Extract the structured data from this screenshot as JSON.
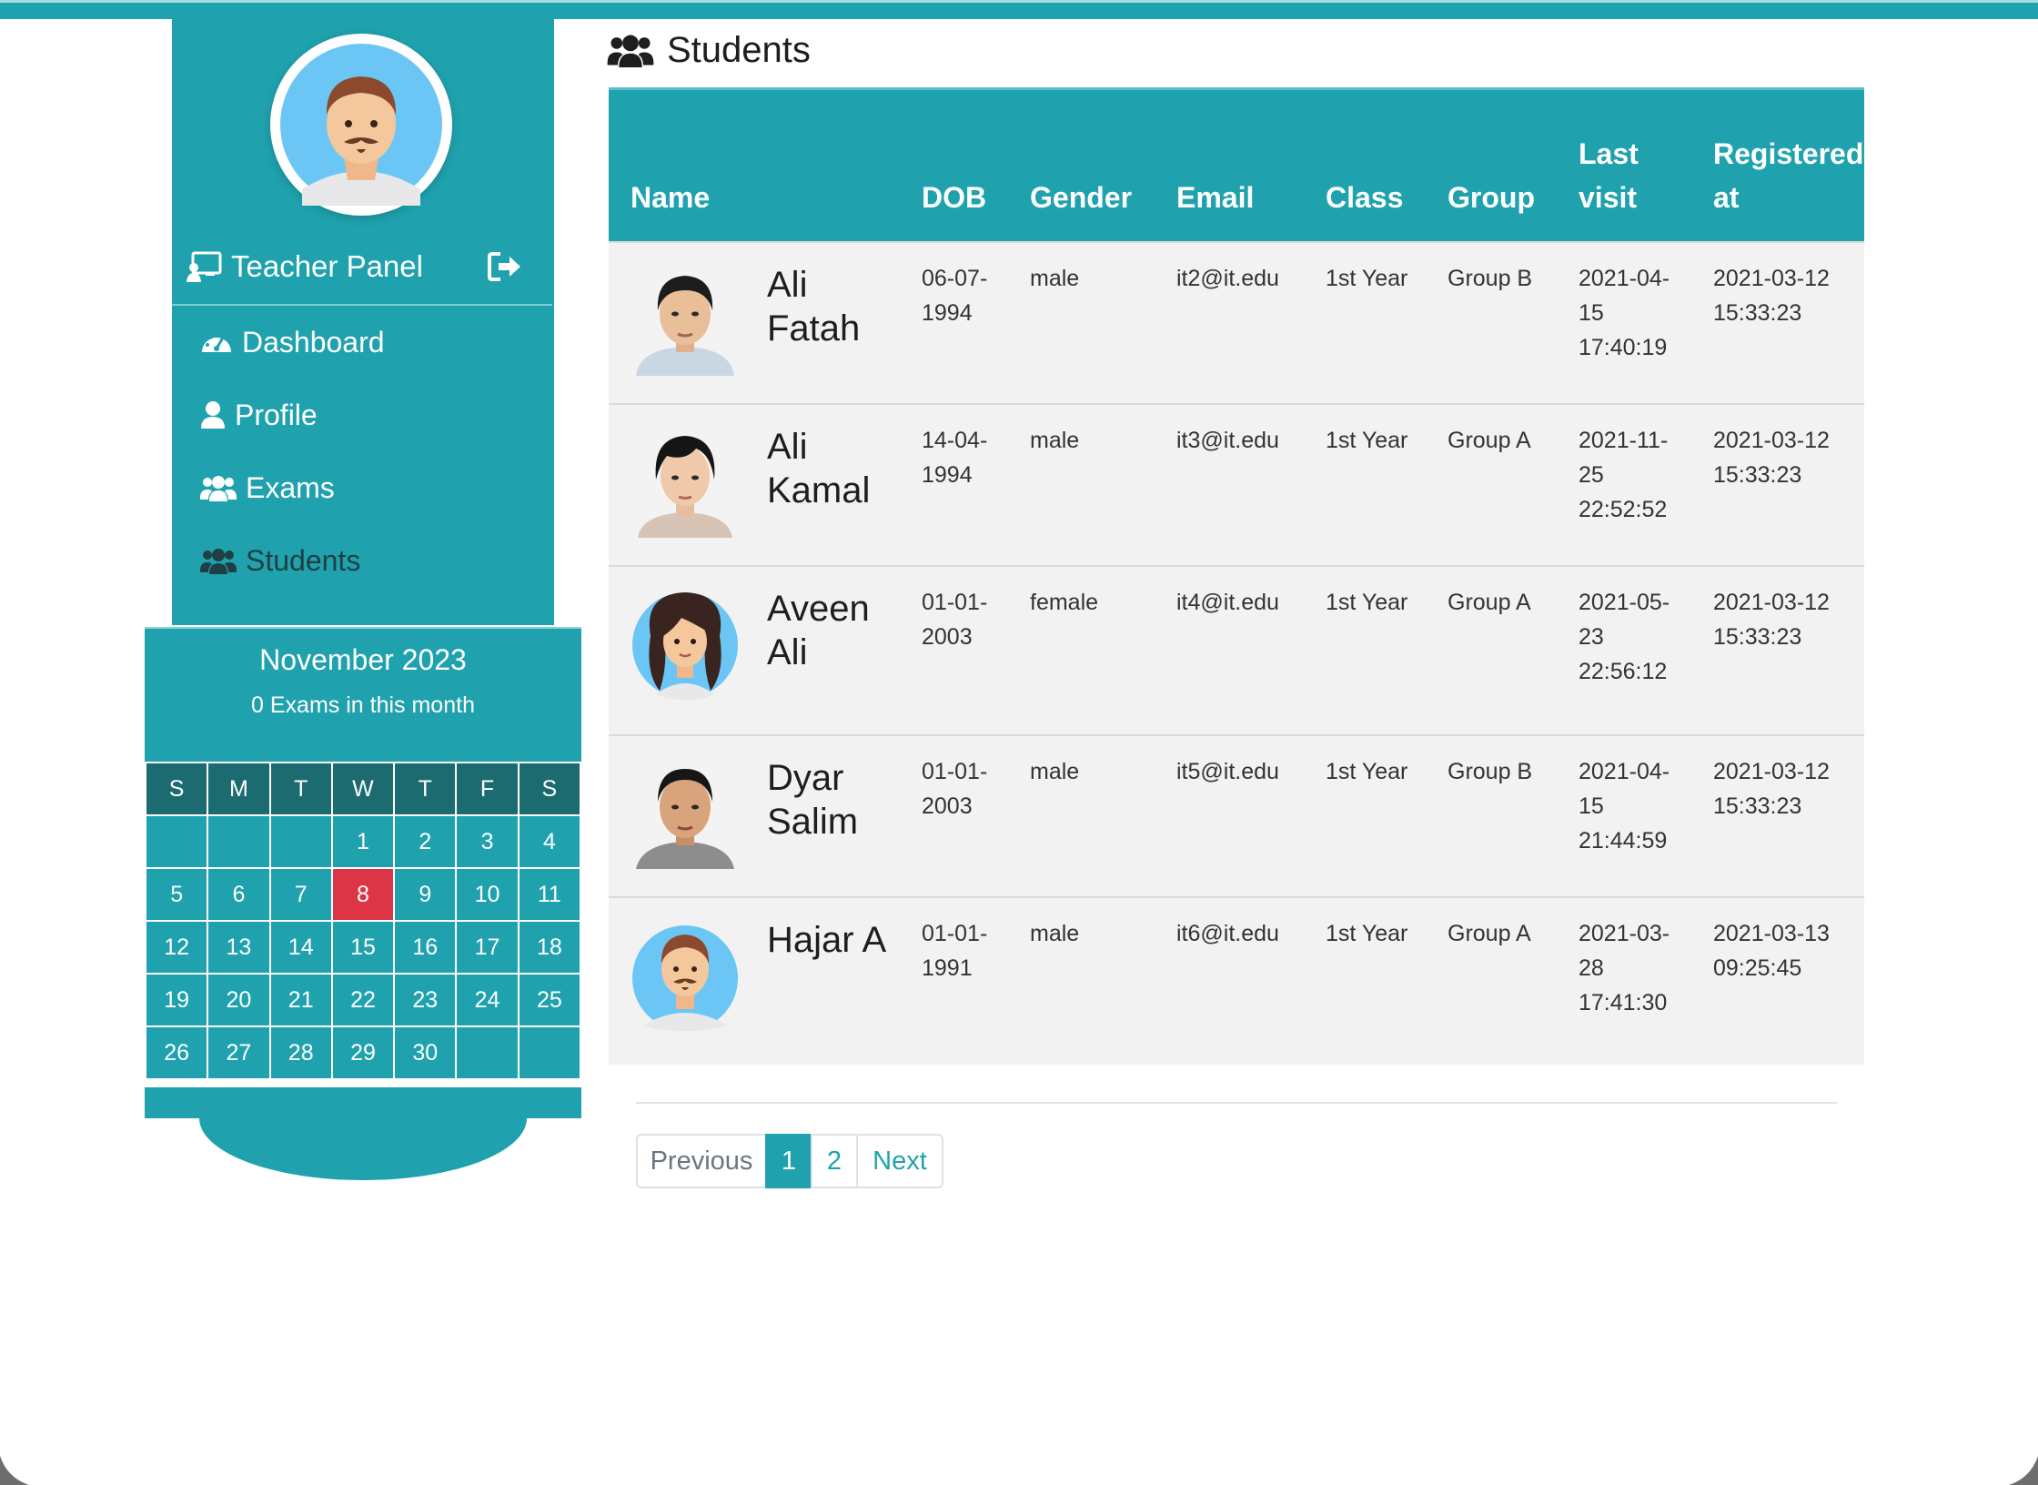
{
  "colors": {
    "accent": "#1fa2ae",
    "accent_dark": "#1b6b70",
    "today": "#dc3545"
  },
  "sidebar": {
    "panel_title": "Teacher Panel",
    "nav": [
      {
        "label": "Dashboard",
        "icon": "gauge-icon"
      },
      {
        "label": "Profile",
        "icon": "user-icon"
      },
      {
        "label": "Exams",
        "icon": "users-icon"
      },
      {
        "label": "Students",
        "icon": "users-icon",
        "active": true
      }
    ]
  },
  "calendar": {
    "month": "November 2023",
    "exam_count": "0 Exams in this month",
    "weekdays": [
      "S",
      "M",
      "T",
      "W",
      "T",
      "F",
      "S"
    ],
    "weeks": [
      [
        "",
        "",
        "",
        "1",
        "2",
        "3",
        "4"
      ],
      [
        "5",
        "6",
        "7",
        "8",
        "9",
        "10",
        "11"
      ],
      [
        "12",
        "13",
        "14",
        "15",
        "16",
        "17",
        "18"
      ],
      [
        "19",
        "20",
        "21",
        "22",
        "23",
        "24",
        "25"
      ],
      [
        "26",
        "27",
        "28",
        "29",
        "30",
        "",
        ""
      ]
    ],
    "today": "8"
  },
  "main": {
    "title": "Students",
    "columns": [
      "Name",
      "DOB",
      "Gender",
      "Email",
      "Class",
      "Group",
      "Last visit",
      "Registered at"
    ],
    "rows": [
      {
        "name": "Ali Fatah",
        "dob": "06-07-1994",
        "gender": "male",
        "email": "it2@it.edu",
        "class": "1st Year",
        "group": "Group B",
        "last_visit": "2021-04-15 17:40:19",
        "registered": "2021-03-12 15:33:23",
        "photo": "photo-male-asian"
      },
      {
        "name": "Ali Kamal",
        "dob": "14-04-1994",
        "gender": "male",
        "email": "it3@it.edu",
        "class": "1st Year",
        "group": "Group A",
        "last_visit": "2021-11-25 22:52:52",
        "registered": "2021-03-12 15:33:23",
        "photo": "photo-male-asian-2"
      },
      {
        "name": "Aveen Ali",
        "dob": "01-01-2003",
        "gender": "female",
        "email": "it4@it.edu",
        "class": "1st Year",
        "group": "Group A",
        "last_visit": "2021-05-23 22:56:12",
        "registered": "2021-03-12 15:33:23",
        "photo": "avatar-female"
      },
      {
        "name": "Dyar Salim",
        "dob": "01-01-2003",
        "gender": "male",
        "email": "it5@it.edu",
        "class": "1st Year",
        "group": "Group B",
        "last_visit": "2021-04-15 21:44:59",
        "registered": "2021-03-12 15:33:23",
        "photo": "photo-male-asian-3"
      },
      {
        "name": "Hajar A",
        "dob": "01-01-1991",
        "gender": "male",
        "email": "it6@it.edu",
        "class": "1st Year",
        "group": "Group A",
        "last_visit": "2021-03-28 17:41:30",
        "registered": "2021-03-13 09:25:45",
        "photo": "avatar-male"
      }
    ]
  },
  "pagination": {
    "previous": "Previous",
    "pages": [
      "1",
      "2"
    ],
    "current": "1",
    "next": "Next"
  }
}
